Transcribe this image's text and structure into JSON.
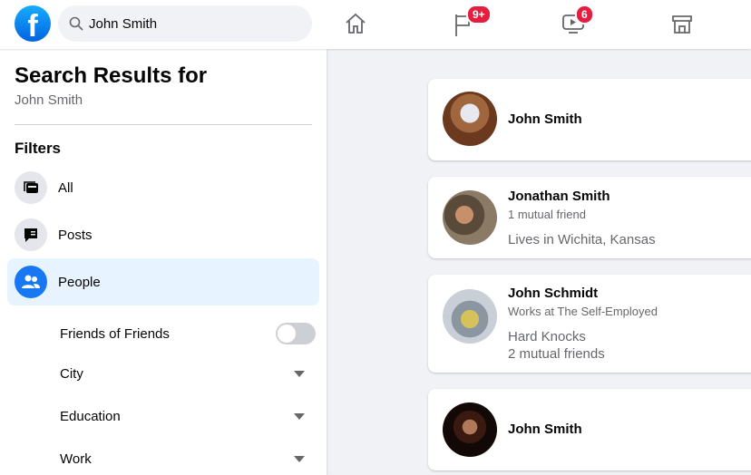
{
  "header": {
    "search_value": "John Smith",
    "notifications_badge": "9+",
    "watch_badge": "6",
    "brand_color": "#1877f2",
    "badge_color": "#e41e3f"
  },
  "sidebar": {
    "title": "Search Results for",
    "query": "John Smith",
    "filters_label": "Filters",
    "items": [
      {
        "label": "All",
        "icon": "feed-icon"
      },
      {
        "label": "Posts",
        "icon": "speech-bubble-icon"
      },
      {
        "label": "People",
        "icon": "people-icon",
        "selected": true
      }
    ],
    "sub_filters": [
      {
        "label": "Friends of Friends",
        "type": "toggle",
        "on": false
      },
      {
        "label": "City",
        "type": "dropdown"
      },
      {
        "label": "Education",
        "type": "dropdown"
      },
      {
        "label": "Work",
        "type": "dropdown"
      }
    ]
  },
  "results": [
    {
      "name": "John Smith",
      "lines": []
    },
    {
      "name": "Jonathan Smith",
      "lines": [
        "1 mutual friend",
        "Lives in Wichita, Kansas"
      ]
    },
    {
      "name": "John Schmidt",
      "lines": [
        "Works at The Self-Employed",
        "Hard Knocks",
        "2 mutual friends"
      ]
    },
    {
      "name": "John Smith",
      "lines": []
    }
  ]
}
